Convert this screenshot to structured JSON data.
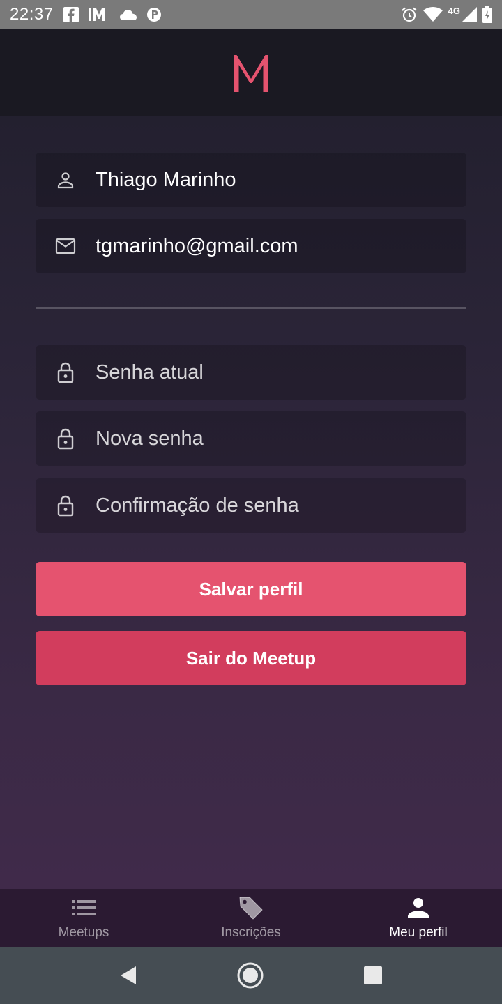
{
  "status_bar": {
    "time": "22:37",
    "left_icons": [
      "facebook-icon",
      "im-icon",
      "cloud-icon",
      "p-icon"
    ],
    "network_label": "4G",
    "right_icons": [
      "alarm-icon",
      "wifi-icon",
      "signal-icon",
      "battery-charging-icon"
    ]
  },
  "header": {
    "logo_letter": "M",
    "logo_color": "#e5536f"
  },
  "form": {
    "name": {
      "icon": "person-icon",
      "value": "Thiago Marinho"
    },
    "email": {
      "icon": "mail-icon",
      "value": "tgmarinho@gmail.com"
    },
    "old_password": {
      "icon": "lock-icon",
      "placeholder": "Senha atual"
    },
    "new_password": {
      "icon": "lock-icon",
      "placeholder": "Nova senha"
    },
    "confirm_password": {
      "icon": "lock-icon",
      "placeholder": "Confirmação de senha"
    }
  },
  "buttons": {
    "save_label": "Salvar perfil",
    "save_color": "#e5536f",
    "logout_label": "Sair do Meetup",
    "logout_color": "#d23d5d"
  },
  "tabs": [
    {
      "label": "Meetups",
      "icon": "list-icon",
      "active": false
    },
    {
      "label": "Inscrições",
      "icon": "tag-icon",
      "active": false
    },
    {
      "label": "Meu perfil",
      "icon": "person-icon",
      "active": true
    }
  ],
  "system_nav": [
    "back-icon",
    "home-icon",
    "recents-icon"
  ]
}
